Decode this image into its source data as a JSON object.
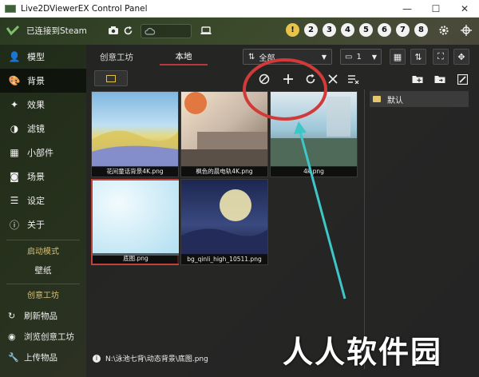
{
  "window": {
    "title": "Live2DViewerEX Control Panel",
    "minimize": "—",
    "maximize": "☐",
    "close": "✕"
  },
  "toolbar": {
    "status": "已连接到Steam",
    "slots": [
      "!",
      "2",
      "3",
      "4",
      "5",
      "6",
      "7",
      "8"
    ]
  },
  "sidebar": {
    "items": [
      {
        "label": "模型",
        "icon": "person-icon"
      },
      {
        "label": "背景",
        "icon": "palette-icon"
      },
      {
        "label": "效果",
        "icon": "sparkle-icon"
      },
      {
        "label": "滤镜",
        "icon": "contrast-icon"
      },
      {
        "label": "小部件",
        "icon": "widgets-icon"
      },
      {
        "label": "场景",
        "icon": "camera-icon"
      },
      {
        "label": "设定",
        "icon": "sliders-icon"
      },
      {
        "label": "关于",
        "icon": "info-icon"
      }
    ],
    "startup_mode_label": "启动模式",
    "startup_mode_value": "壁纸",
    "workshop_label": "创意工坊",
    "workshop_items": [
      {
        "label": "刷新物品",
        "icon": "refresh-icon"
      },
      {
        "label": "浏览创意工坊",
        "icon": "eye-icon"
      },
      {
        "label": "上传物品",
        "icon": "wrench-icon"
      }
    ]
  },
  "main": {
    "tabs": [
      {
        "label": "创意工坊",
        "active": false
      },
      {
        "label": "本地",
        "active": true
      }
    ],
    "filter_value": "全部",
    "monitor_value": "1",
    "tooltip": "添加",
    "cards": [
      {
        "caption": "花间童话背景4K.png",
        "selected": false
      },
      {
        "caption": "枫色的晨电轨4K.png",
        "selected": false
      },
      {
        "caption": "4k.png",
        "selected": false
      },
      {
        "caption": "底图.png",
        "selected": true
      },
      {
        "caption": "bg_qinli_high_10511.png",
        "selected": false
      }
    ],
    "folders": [
      {
        "label": "默认"
      }
    ],
    "status_path": "N:\\泳池七背\\动态背景\\底图.png"
  },
  "watermark": "人人软件园",
  "colors": {
    "accent_red": "#c0423d",
    "slot_active": "#e6c34a",
    "annotation_arrow": "#3fc6c8"
  }
}
